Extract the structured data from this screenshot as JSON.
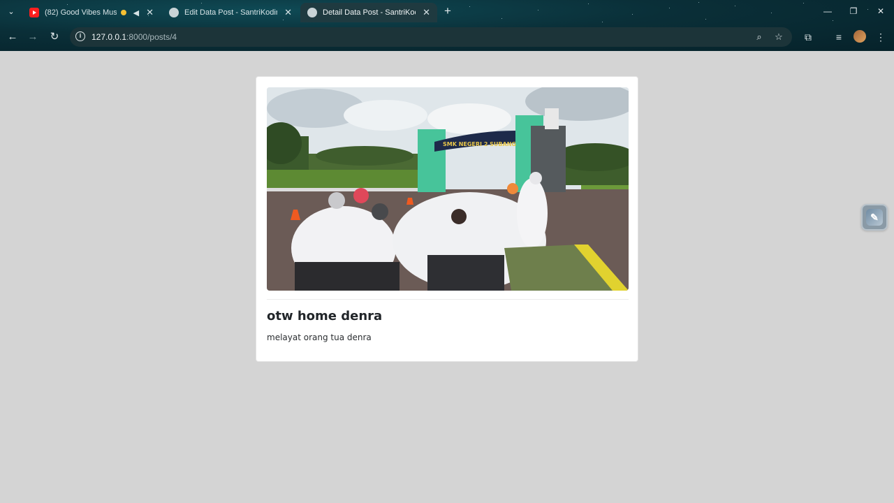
{
  "browser": {
    "tabs": [
      {
        "title": "(82) Good Vibes Music",
        "icon": "youtube-icon",
        "playing": true,
        "active": false
      },
      {
        "title": "Edit Data Post - SantriKoding.c",
        "icon": "globe-icon",
        "active": false
      },
      {
        "title": "Detail Data Post - SantriKoding",
        "icon": "globe-icon",
        "active": true
      }
    ],
    "address": {
      "host": "127.0.0.1",
      "path": ":8000/posts/4"
    }
  },
  "post": {
    "image_alt": "SMK NEGERI 2 SUBANG",
    "gate_sign": "SMK NEGERI 2 SUBANG",
    "title": "otw home denra",
    "content": "melayat orang tua denra"
  },
  "colors": {
    "page_background": "#d4d4d4",
    "card_background": "#ffffff",
    "chrome_background": "#0a2f38"
  }
}
